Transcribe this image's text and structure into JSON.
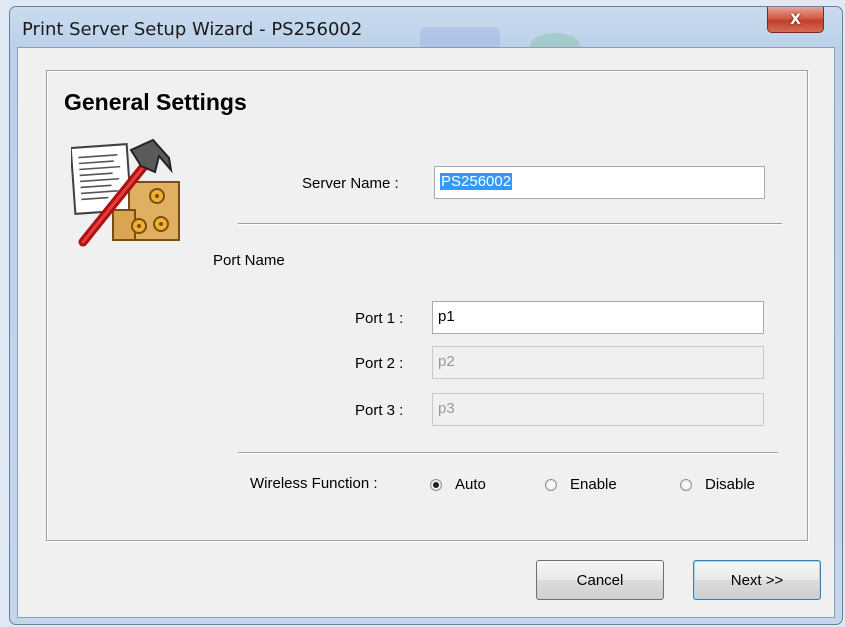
{
  "window": {
    "title": "Print Server Setup Wizard - PS256002",
    "close_glyph": "X"
  },
  "page": {
    "heading": "General Settings",
    "icon": "tools-document-icon"
  },
  "server": {
    "label": "Server Name :",
    "value": "PS256002"
  },
  "ports": {
    "section_label": "Port Name",
    "items": [
      {
        "label": "Port 1 :",
        "value": "p1",
        "enabled": true
      },
      {
        "label": "Port 2 :",
        "value": "p2",
        "enabled": false
      },
      {
        "label": "Port 3 :",
        "value": "p3",
        "enabled": false
      }
    ]
  },
  "wireless": {
    "label": "Wireless Function :",
    "options": [
      "Auto",
      "Enable",
      "Disable"
    ],
    "selected": "Auto"
  },
  "buttons": {
    "cancel": "Cancel",
    "next": "Next >>"
  }
}
